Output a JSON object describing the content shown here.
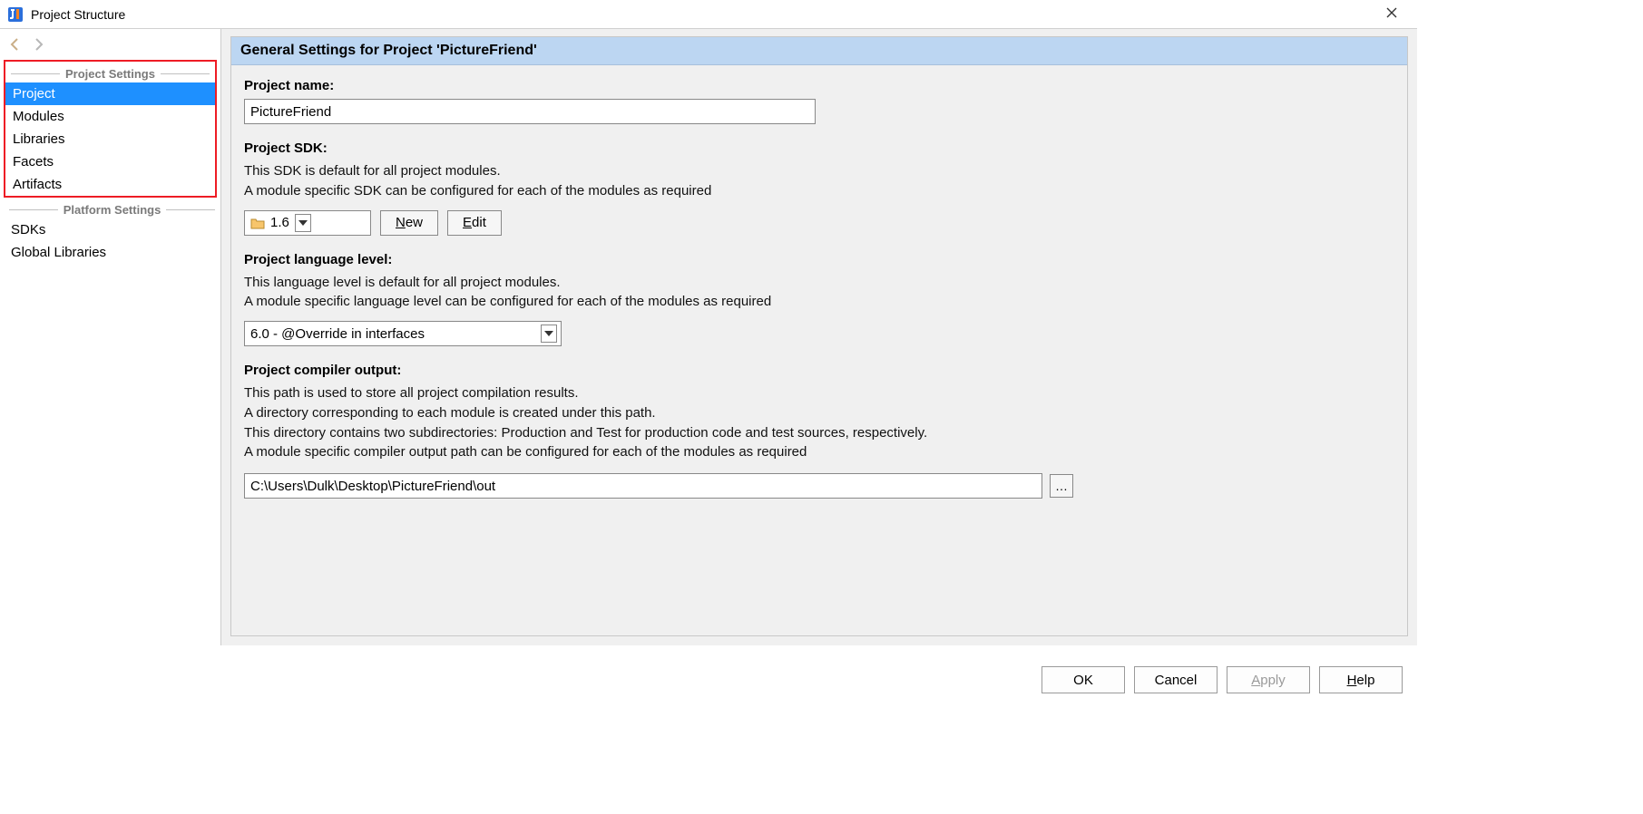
{
  "window": {
    "title": "Project Structure"
  },
  "sidebar": {
    "sections": {
      "project_settings_label": "Project Settings",
      "platform_settings_label": "Platform Settings"
    },
    "project_items": [
      "Project",
      "Modules",
      "Libraries",
      "Facets",
      "Artifacts"
    ],
    "platform_items": [
      "SDKs",
      "Global Libraries"
    ],
    "selected": "Project"
  },
  "main": {
    "header": "General Settings for Project 'PictureFriend'",
    "project_name": {
      "label": "Project name:",
      "value": "PictureFriend"
    },
    "sdk": {
      "label": "Project SDK:",
      "desc1": "This SDK is default for all project modules.",
      "desc2": "A module specific SDK can be configured for each of the modules as required",
      "value": "1.6",
      "new_label": "New",
      "edit_label": "Edit"
    },
    "lang": {
      "label": "Project language level:",
      "desc1": "This language level is default for all project modules.",
      "desc2": "A module specific language level can be configured for each of the modules as required",
      "value": "6.0 - @Override in interfaces"
    },
    "output": {
      "label": "Project compiler output:",
      "desc1": "This path is used to store all project compilation results.",
      "desc2": "A directory corresponding to each module is created under this path.",
      "desc3": "This directory contains two subdirectories: Production and Test for production code and test sources, respectively.",
      "desc4": "A module specific compiler output path can be configured for each of the modules as required",
      "value": "C:\\Users\\Dulk\\Desktop\\PictureFriend\\out"
    }
  },
  "footer": {
    "ok": "OK",
    "cancel": "Cancel",
    "apply": "Apply",
    "help": "Help"
  }
}
